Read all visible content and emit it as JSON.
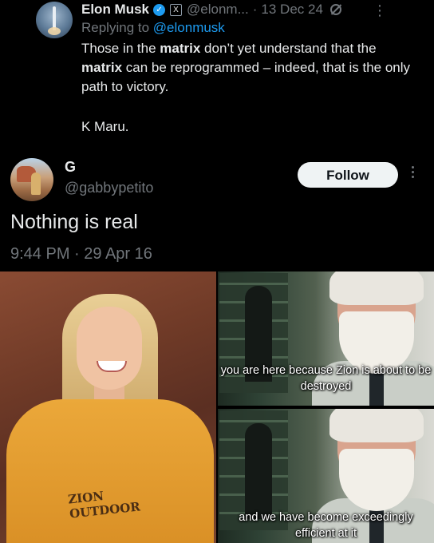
{
  "reply": {
    "author_name": "Elon Musk",
    "x_badge": "X",
    "handle": "@elonm...",
    "separator": "·",
    "date": "13 Dec 24",
    "more": "⋮",
    "replying_prefix": "Replying to",
    "replying_to": "@elonmusk",
    "body_parts": [
      "Those in the ",
      "matrix",
      " don’t yet understand that the ",
      "matrix",
      " can be reprogrammed – indeed, that is the only path to victory."
    ],
    "signature": "K Maru."
  },
  "tweet": {
    "author_name": "G",
    "handle": "@gabbypetito",
    "follow_label": "Follow",
    "text": "Nothing is real",
    "timestamp": "9:44 PM · 29 Apr 16"
  },
  "media": {
    "photo_shirt_text_1": "ZION",
    "photo_shirt_text_2": "OUTDOOR",
    "caption_top": "you are here because Zion is about to be destroyed",
    "caption_bottom": "and we have become exceedingly efficient at it"
  },
  "colors": {
    "background": "#000000",
    "text": "#e7e9ea",
    "muted": "#71767b",
    "link": "#1d9bf0",
    "verified": "#1d9bf0",
    "follow_bg": "#eff3f4"
  }
}
